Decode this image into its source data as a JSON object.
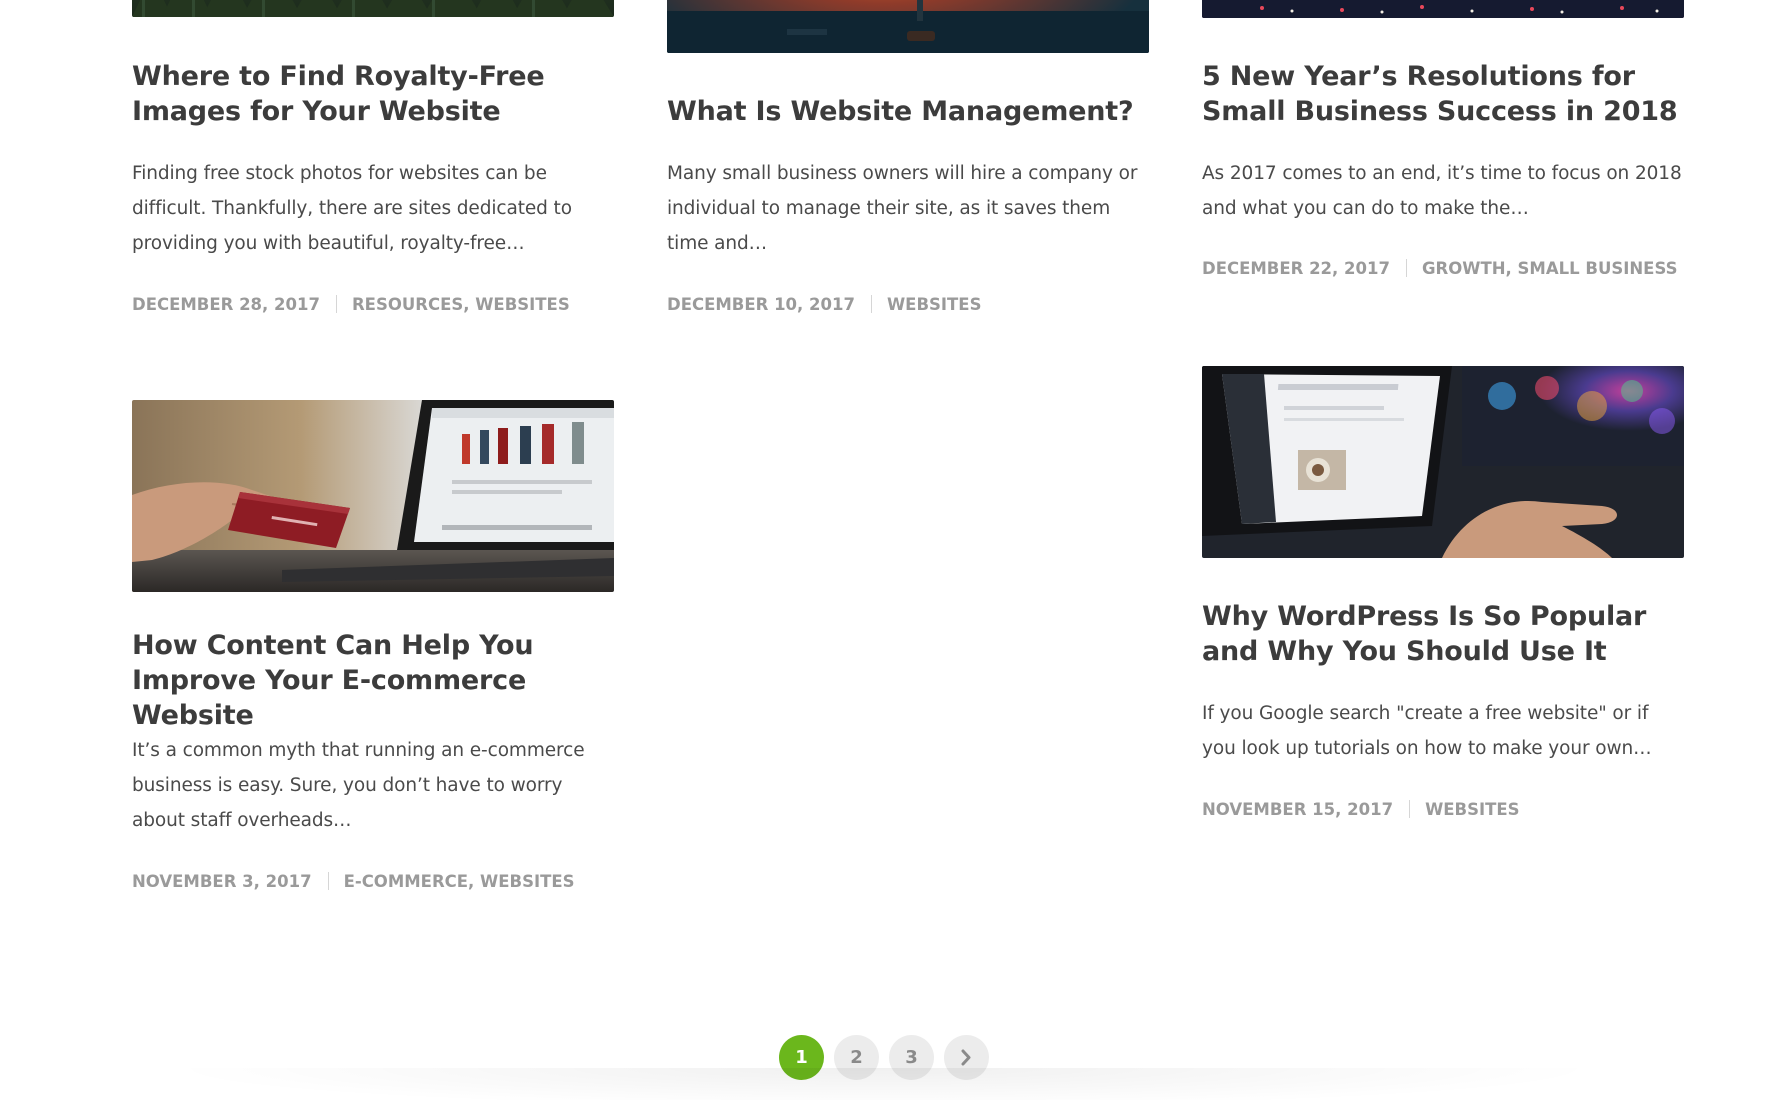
{
  "posts": [
    {
      "title": "Where to Find Royalty-Free Images for Your Website",
      "excerpt": "Finding free stock photos for websites can be difficult. Thankfully, there are sites dedicated to providing you with beautiful, royalty-free…",
      "date": "December 28, 2017",
      "categories": "Resources, Websites",
      "image": "forest-photo"
    },
    {
      "title": "What Is Website Management?",
      "excerpt": "Many small business owners will hire a company or individual to manage their site, as it saves them time and…",
      "date": "December 10, 2017",
      "categories": "Websites",
      "image": "desk-sunset-photo"
    },
    {
      "title": "5 New Year’s Resolutions for Small Business Success in 2018",
      "excerpt": "As 2017 comes to an end, it’s time to focus on 2018 and what you can do to make the…",
      "date": "December 22, 2017",
      "categories": "Growth, Small Business",
      "image": "city-night-photo"
    },
    {
      "title": "How Content Can Help You Improve Your E-commerce Website",
      "excerpt": "It’s a common myth that running an e-commerce business is easy. Sure, you don’t have to worry about staff overheads…",
      "date": "November 3, 2017",
      "categories": "E-commerce, Websites",
      "image": "credit-card-laptop-photo"
    },
    {
      "title": "Why WordPress Is So Popular and Why You Should Use It",
      "excerpt": "If you Google search \"create a free website\" or if you look up tutorials on how to make your own…",
      "date": "November 15, 2017",
      "categories": "Websites",
      "image": "wordpress-laptop-photo"
    }
  ],
  "pagination": {
    "pages": [
      "1",
      "2",
      "3"
    ],
    "current": "1",
    "next_icon": "chevron-right-icon"
  },
  "colors": {
    "accent": "#6bb71c",
    "title": "#3c3c3c",
    "meta": "#9a9a9a"
  }
}
